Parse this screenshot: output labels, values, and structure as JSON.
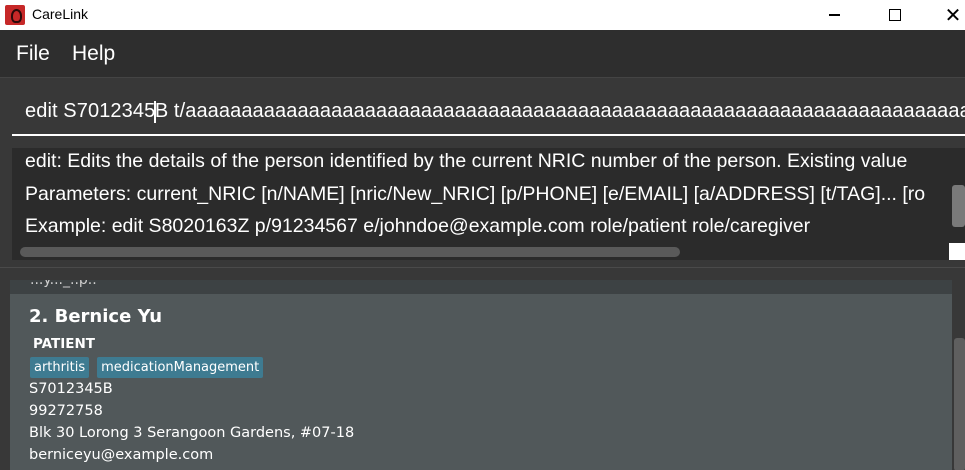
{
  "window": {
    "title": "CareLink",
    "icons": [
      "carelink-app-icon",
      "minimize-icon",
      "maximize-icon",
      "close-icon"
    ]
  },
  "menu": {
    "file_label": "File",
    "help_label": "Help"
  },
  "command": {
    "before_caret": "edit S7012345",
    "after_caret": "B t/aaaaaaaaaaaaaaaaaaaaaaaaaaaaaaaaaaaaaaaaaaaaaaaaaaaaaaaaaaaaaaaaaaaaaaaa"
  },
  "result": {
    "line1": "edit: Edits the details of the person identified by the current NRIC number of the person. Existing value",
    "line2": "Parameters: current_NRIC [n/NAME] [nric/New_NRIC] [p/PHONE] [e/EMAIL] [a/ADDRESS] [t/TAG]... [ro",
    "line3": "Example: edit S8020163Z p/91234567 e/johndoe@example.com role/patient role/caregiver"
  },
  "person_list": {
    "previous_card_fragment": "...y..._..p..",
    "card": {
      "index_name": "2. Bernice Yu",
      "role": "PATIENT",
      "tags": [
        "arthritis",
        "medicationManagement"
      ],
      "nric": "S7012345B",
      "phone": "99272758",
      "address": "Blk 30 Lorong 3 Serangoon Gardens, #07-18",
      "email": "berniceyu@example.com"
    }
  },
  "colors": {
    "menubar_bg": "#2e2e2e",
    "panel_bg": "#383838",
    "result_bg": "#2b2b2b",
    "card_bg": "#51585a",
    "tag_bg": "#3e7b91",
    "icon_red": "#c62828"
  }
}
